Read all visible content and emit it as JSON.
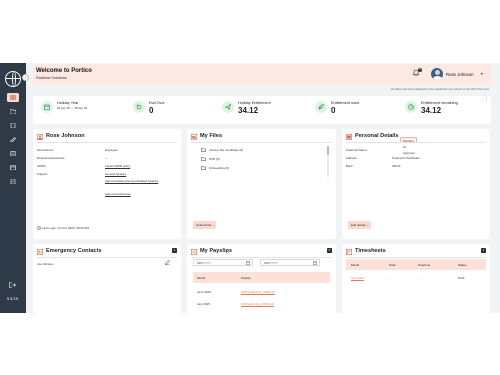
{
  "app": {
    "version": "V 3.7.0"
  },
  "header": {
    "title": "Welcome to Portico",
    "subtitle": "Radhost Solutions",
    "notifications": "0",
    "user_name": "Rose Johnson",
    "timezone_note": "All dates and times displayed in the application are shown in the HKT time zone."
  },
  "stats": [
    {
      "label": "Holiday Year",
      "sub": "26 Apr 25 — 25 Apr 26"
    },
    {
      "label": "Roll Over",
      "value": "0"
    },
    {
      "label": "Holiday Entitlement",
      "value": "34.12"
    },
    {
      "label": "Entitlement used",
      "value": "0"
    },
    {
      "label": "Entitlement remaining",
      "value": "34.12"
    }
  ],
  "profile": {
    "name": "Rose Johnson",
    "rows": [
      {
        "k": "Permissions:",
        "v": "Employee"
      },
      {
        "k": "Departmental Access:",
        "v": "—"
      },
      {
        "k": "GDPR:",
        "v": "Latest GDPR policy"
      },
      {
        "k": "Support:",
        "v": "General Queries"
      }
    ],
    "support_links": [
      "Approved Expenses and Related Queries",
      "Approved Absences"
    ],
    "last_login": "Last Login: 13 Nov 2025, 05:22 PM"
  },
  "files": {
    "title": "My Files",
    "folders": [
      "Income Tax Certificate (0)",
      "KPR (0)",
      "Onboarding (0)"
    ],
    "upload_label": "Upload File"
  },
  "personal": {
    "title": "Personal Details",
    "status": "Pending for Approval",
    "rows": [
      {
        "k": "Preferred Name:",
        "v": ""
      },
      {
        "k": "Address:",
        "v": "Topfoundo Worldwide"
      },
      {
        "k": "Bank:",
        "v": "IDFCK"
      }
    ],
    "edit_label": "Edit details"
  },
  "emergency": {
    "title": "Emergency Contacts",
    "count": "1",
    "contact": "Joe Johnson"
  },
  "payslips": {
    "title": "My Payslips",
    "count": "2",
    "from_placeholder": "MM/YYYY",
    "to_placeholder": "MM/YYYY",
    "columns": [
      "Month",
      "Payslip"
    ],
    "rows": [
      {
        "month": "June 2025",
        "file": "CNPayslipJune_2025.pdf"
      },
      {
        "month": "July 2025",
        "file": "CNPayslipJuly_2025.pdf"
      }
    ]
  },
  "timesheets": {
    "title": "Timesheets",
    "count": "1",
    "columns": [
      "Month",
      "Total",
      "Overtime",
      "Status"
    ],
    "row": {
      "month": "Nov 2025",
      "total": "-",
      "overtime": "-",
      "status": "Draft"
    }
  }
}
